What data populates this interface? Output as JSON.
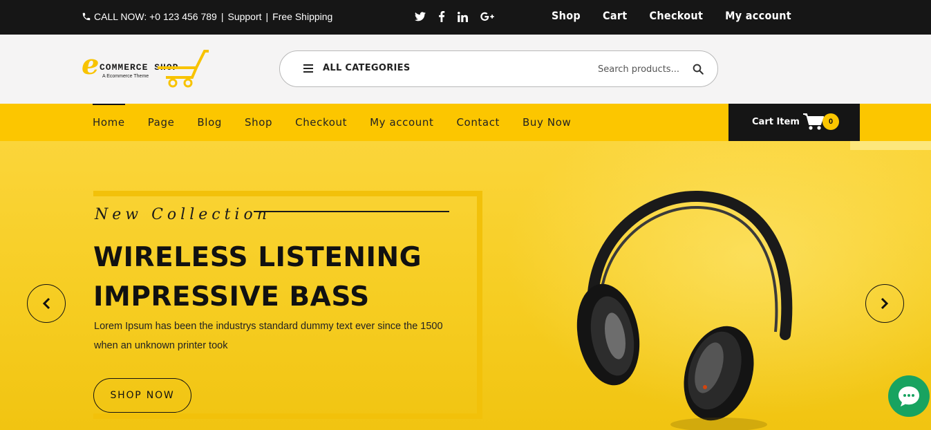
{
  "topbar": {
    "phone_text": "CALL NOW: +0 123 456 789",
    "support_label": "Support",
    "shipping_label": "Free Shipping",
    "social": [
      "twitter-icon",
      "facebook-icon",
      "linkedin-icon",
      "google-plus-icon"
    ],
    "social_glyphs": [
      "𝕥",
      "f",
      "in",
      "G+"
    ],
    "links": [
      "Shop",
      "Cart",
      "Checkout",
      "My account"
    ]
  },
  "header": {
    "logo_letter": "e",
    "logo_brand": "COMMERCE SHOP",
    "logo_tagline": "A Ecommerce Theme",
    "category_label": "ALL CATEGORIES",
    "search_placeholder": "Search products..."
  },
  "nav": {
    "items": [
      "Home",
      "Page",
      "Blog",
      "Shop",
      "Checkout",
      "My account",
      "Contact",
      "Buy Now"
    ],
    "active": "Home",
    "cart_label": "Cart Item",
    "cart_count": "0"
  },
  "hero": {
    "kicker": "New Collection",
    "title_line1": "WIRELESS LISTENING",
    "title_line2": "IMPRESSIVE BASS",
    "text": "Lorem Ipsum has been the industrys standard dummy text ever since the 1500 when an unknown printer took",
    "button_label": "SHOP NOW"
  },
  "colors": {
    "accent": "#fcc600",
    "dark": "#161616",
    "chat": "#18a360"
  }
}
